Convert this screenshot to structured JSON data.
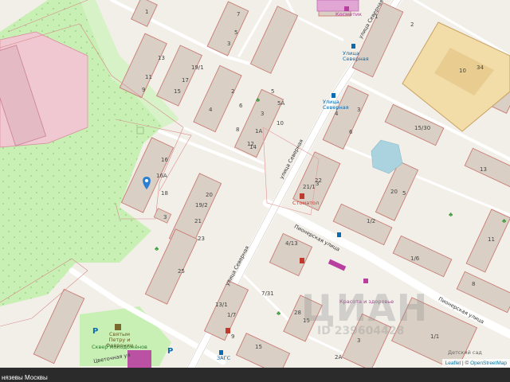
{
  "map": {
    "street_labels": {
      "severnaya_upper": "улица Северная",
      "severnaya_mid": "улица Северная",
      "severnaya_lower": "улица Северная",
      "pionerskaya_left": "Пионерская улица",
      "pionerskaya_right": "Пионерская улица",
      "tsvetochnaya": "Цветочная ул"
    },
    "pois": {
      "kosmetik": "Косметик",
      "bus_stop_top": "Улица Северная",
      "bus_stop_mid": "Улица Северная",
      "pharmacy": "Стоматол",
      "kids": "Детский сад",
      "beauty": "Красота и здоровье",
      "monument": "Святым Петру и Февронии",
      "square": "Сквер молодожёнов",
      "detsad_bottom": "Детский сад",
      "bus_stop_bottom": "ЗАГС",
      "parking": "P"
    },
    "house_numbers": [
      "7",
      "5",
      "3",
      "1",
      "13",
      "11",
      "9",
      "19/1",
      "17",
      "15",
      "2",
      "4",
      "6",
      "8",
      "1А",
      "3",
      "5",
      "5А",
      "10",
      "12",
      "14",
      "16",
      "16А",
      "18",
      "20",
      "19/2",
      "21",
      "23",
      "25",
      "21/1",
      "1",
      "3",
      "5",
      "15/30",
      "13",
      "11",
      "1/2",
      "3",
      "4/13",
      "7/31",
      "1/6",
      "8",
      "10",
      "6",
      "4",
      "2",
      "22",
      "20",
      "13/1",
      "1/7",
      "28",
      "15",
      "3",
      "1/1",
      "15",
      "9",
      "2А",
      "3",
      "34"
    ]
  },
  "watermark": {
    "brand": "ЦИАН",
    "sub": "ID 239604428"
  },
  "attribution": {
    "leaflet": "Leaflet",
    "separator": " | © ",
    "osm": "OpenStreetMap"
  },
  "bottom_bar": {
    "text": "нязевы Москвы"
  }
}
